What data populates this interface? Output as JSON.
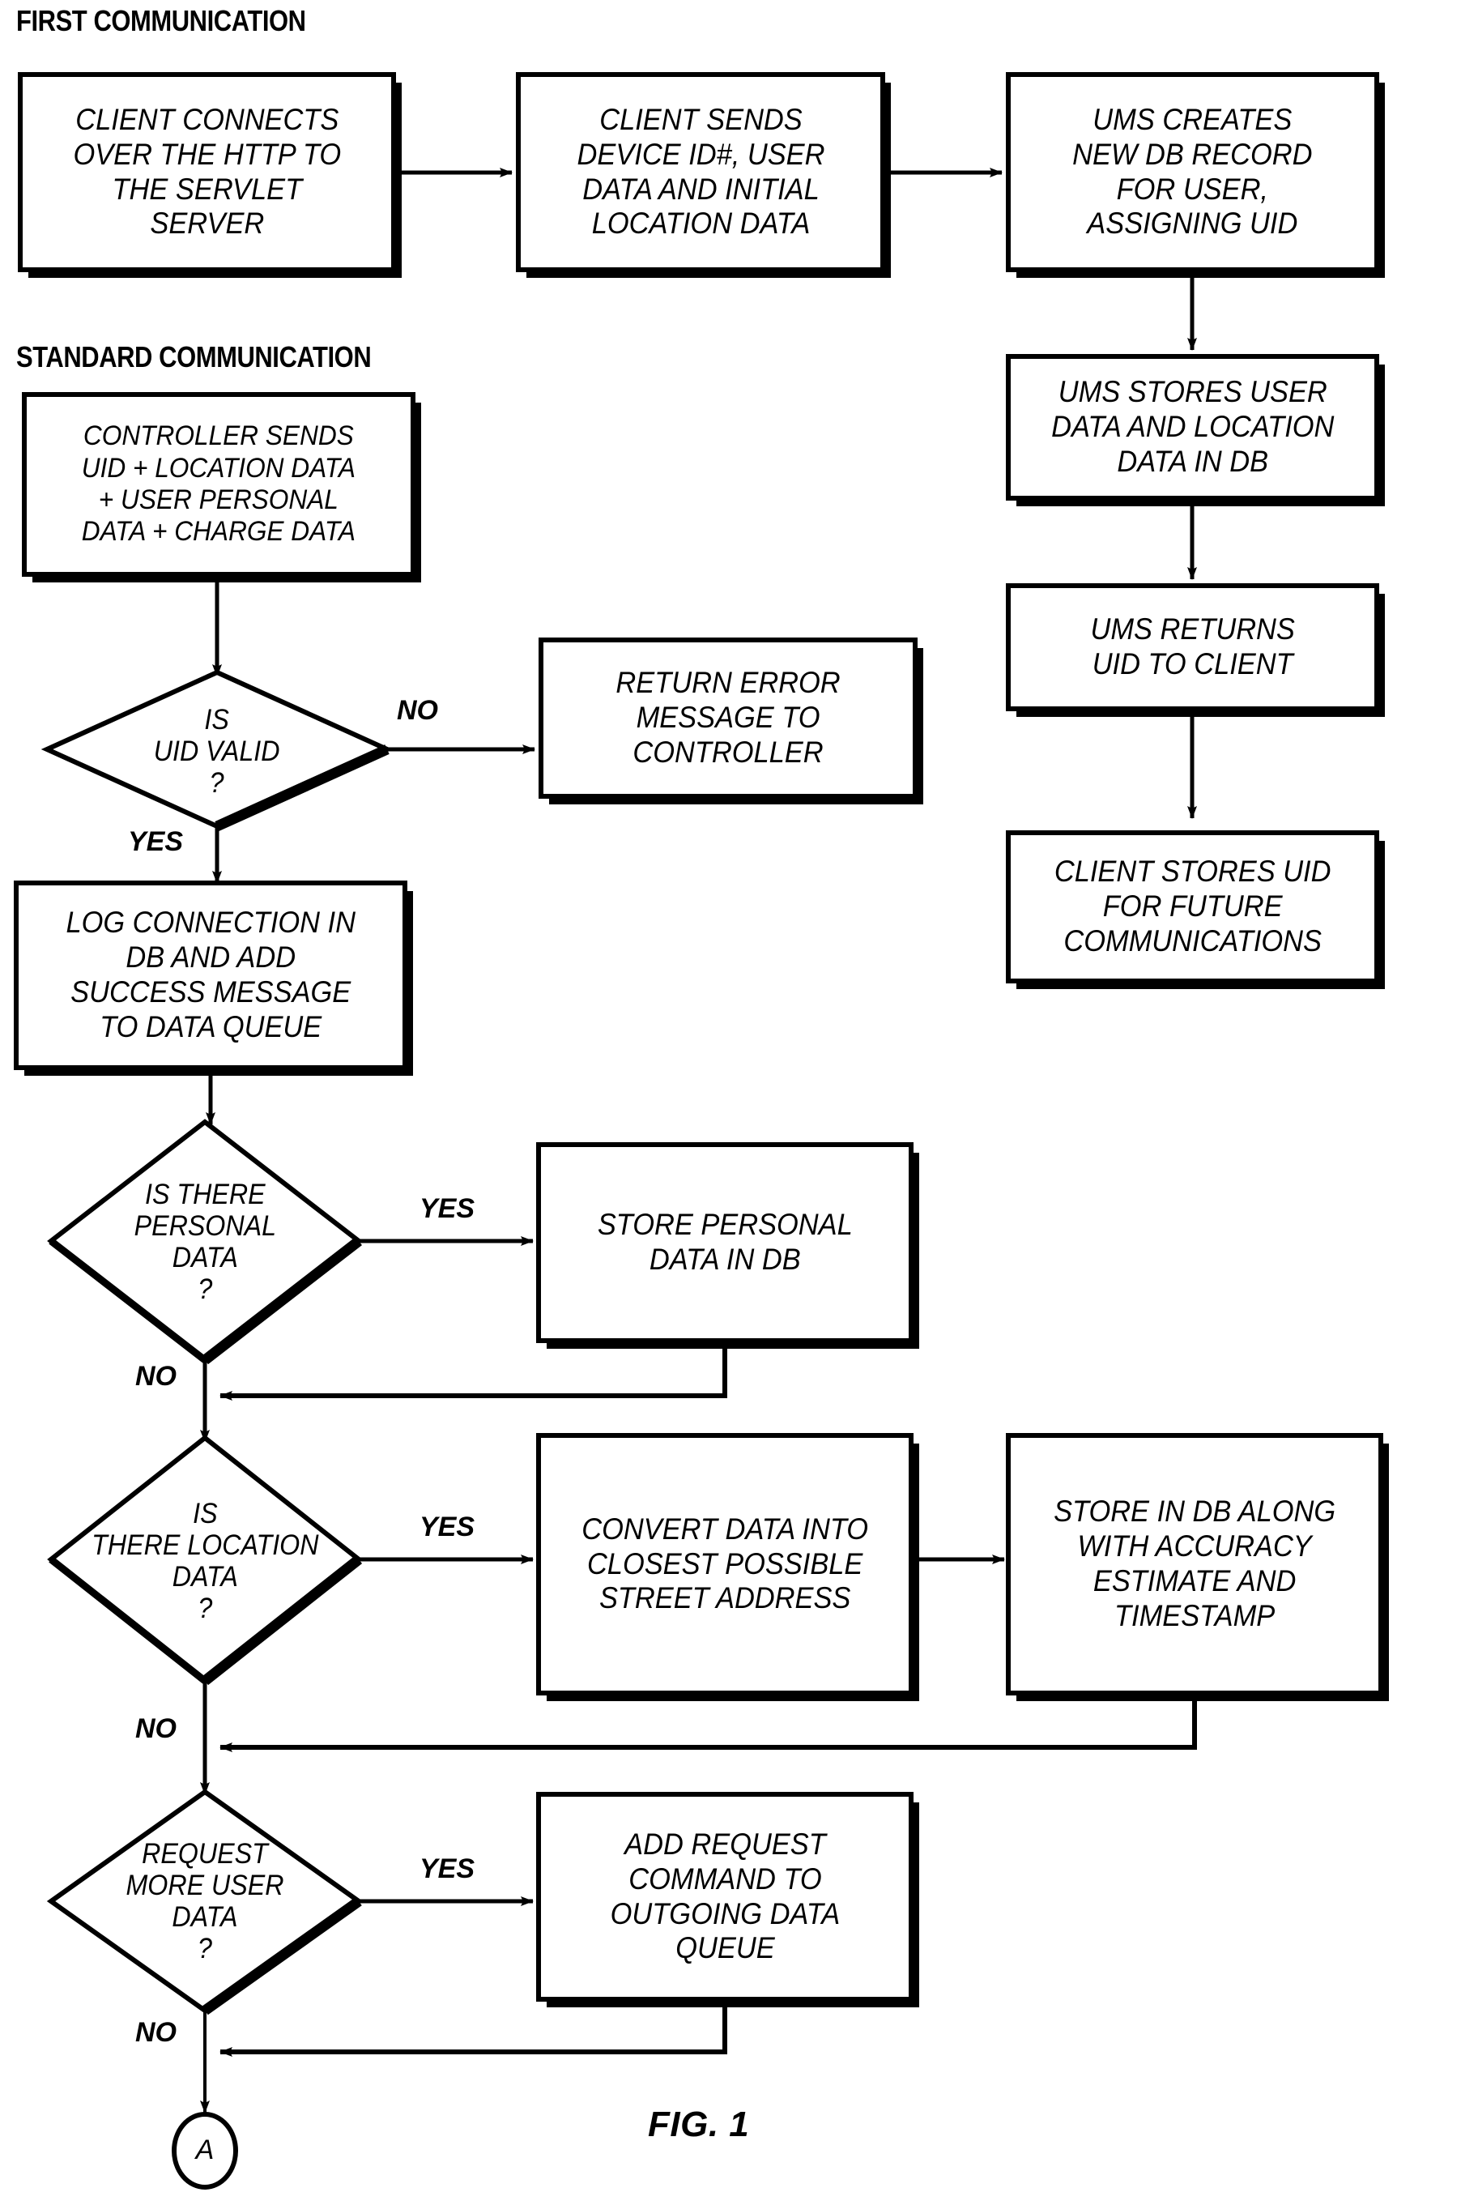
{
  "figure": {
    "caption": "FIG. 1",
    "connector_label": "A"
  },
  "sections": [
    {
      "id": "first-communication",
      "title": "FIRST COMMUNICATION"
    },
    {
      "id": "standard-communication",
      "title": "STANDARD COMMUNICATION"
    }
  ],
  "process_boxes": [
    {
      "id": "client-connects",
      "lines": [
        "CLIENT CONNECTS",
        "OVER THE HTTP TO",
        "THE SERVLET",
        "SERVER"
      ]
    },
    {
      "id": "client-sends",
      "lines": [
        "CLIENT SENDS",
        "DEVICE ID#, USER",
        "DATA AND INITIAL",
        "LOCATION DATA"
      ]
    },
    {
      "id": "ums-creates",
      "lines": [
        "UMS CREATES",
        "NEW DB RECORD",
        "FOR USER,",
        "ASSIGNING UID"
      ]
    },
    {
      "id": "ums-stores",
      "lines": [
        "UMS STORES USER",
        "DATA AND LOCATION",
        "DATA IN DB"
      ]
    },
    {
      "id": "ums-returns",
      "lines": [
        "UMS RETURNS",
        "UID TO CLIENT"
      ]
    },
    {
      "id": "client-stores",
      "lines": [
        "CLIENT STORES UID",
        "FOR FUTURE",
        "COMMUNICATIONS"
      ]
    },
    {
      "id": "controller-sends",
      "lines": [
        "CONTROLLER SENDS",
        "UID + LOCATION DATA",
        "+ USER PERSONAL",
        "DATA + CHARGE DATA"
      ]
    },
    {
      "id": "return-error",
      "lines": [
        "RETURN ERROR",
        "MESSAGE TO",
        "CONTROLLER"
      ]
    },
    {
      "id": "log-connection",
      "lines": [
        "LOG CONNECTION IN",
        "DB AND ADD",
        "SUCCESS MESSAGE",
        "TO DATA QUEUE"
      ]
    },
    {
      "id": "store-personal-data",
      "lines": [
        "STORE PERSONAL",
        "DATA IN DB"
      ]
    },
    {
      "id": "convert-data",
      "lines": [
        "CONVERT DATA INTO",
        "CLOSEST POSSIBLE",
        "STREET ADDRESS"
      ]
    },
    {
      "id": "store-in-db-accuracy",
      "lines": [
        "STORE IN DB ALONG",
        "WITH ACCURACY",
        "ESTIMATE AND",
        "TIMESTAMP"
      ]
    },
    {
      "id": "add-request-command",
      "lines": [
        "ADD REQUEST",
        "COMMAND TO",
        "OUTGOING DATA",
        "QUEUE"
      ]
    }
  ],
  "decisions": [
    {
      "id": "is-uid-valid",
      "lines": [
        "IS",
        "UID VALID",
        "?"
      ],
      "yes": "YES",
      "no": "NO"
    },
    {
      "id": "is-there-personal",
      "lines": [
        "IS THERE",
        "PERSONAL",
        "DATA",
        "?"
      ],
      "yes": "YES",
      "no": "NO"
    },
    {
      "id": "is-there-location",
      "lines": [
        "IS",
        "THERE LOCATION",
        "DATA",
        "?"
      ],
      "yes": "YES",
      "no": "NO"
    },
    {
      "id": "request-more-user",
      "lines": [
        "REQUEST",
        "MORE USER",
        "DATA",
        "?"
      ],
      "yes": "YES",
      "no": "NO"
    }
  ],
  "colors": {
    "ink": "#000000",
    "paper": "#ffffff"
  }
}
